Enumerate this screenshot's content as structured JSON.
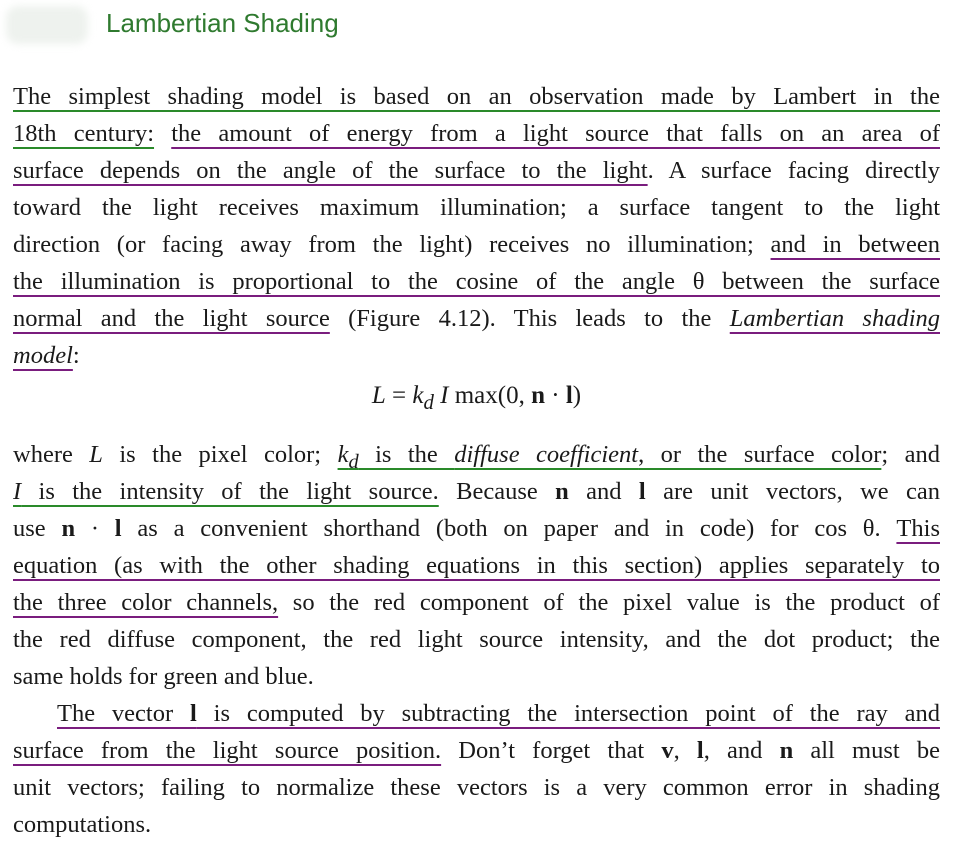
{
  "header": {
    "title": "Lambertian Shading"
  },
  "paragraph1": {
    "lines": [
      [
        "The simplest shading model is based on an observation made by Lambert in the"
      ],
      [
        "18th century:",
        " ",
        "the amount of energy from a light source that falls on an area of"
      ],
      [
        "surface depends on the angle of the surface to the light",
        ". A surface facing directly"
      ],
      [
        "toward the light receives maximum illumination; a surface tangent to the light"
      ],
      [
        "direction (or facing away from the light) receives no illumination; ",
        "and in between"
      ],
      [
        "the illumination is proportional to the cosine of the angle θ between the surface"
      ],
      [
        "normal and the light source",
        " (Figure 4.12). This leads to the ",
        "Lambertian shading"
      ],
      [
        "model",
        ":"
      ]
    ]
  },
  "equation": {
    "L": "L",
    "eq": " = ",
    "k": "k",
    "d": "d",
    "I": " I ",
    "max": "max(0, ",
    "n": "n",
    "dot": " · ",
    "l": "l",
    "close": ")"
  },
  "paragraph2": {
    "lines": [
      [
        "where ",
        "L",
        " is the pixel color; ",
        "k",
        "d",
        " is the ",
        "diffuse coefficient",
        ", or the surface color",
        "; and"
      ],
      [
        "I",
        " is the intensity of the light source.",
        " Because ",
        "n",
        " and ",
        "l",
        " are unit vectors, we can"
      ],
      [
        "use ",
        "n",
        " · ",
        "l",
        " as a convenient shorthand (both on paper and in code) for cos θ. ",
        "This"
      ],
      [
        "equation (as with the other shading equations in this section) applies separately to"
      ],
      [
        "the three color channels,",
        " so the red component of the pixel value is the product of"
      ],
      [
        "the red diffuse component, the red light source intensity, and the dot product; the"
      ],
      [
        "same holds for green and blue."
      ]
    ]
  },
  "paragraph3": {
    "lines": [
      [
        "The vector ",
        "l",
        " is computed by subtracting the intersection point of the ray and"
      ],
      [
        "surface from the light source position.",
        " Don’t forget that ",
        "v",
        ", ",
        "l",
        ", and ",
        "n",
        " all must be"
      ],
      [
        "unit vectors; failing to normalize these vectors is a very common error in shading"
      ],
      [
        "computations."
      ]
    ]
  }
}
